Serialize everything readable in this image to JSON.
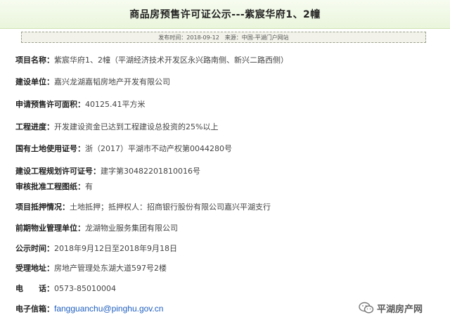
{
  "header": {
    "title": "商品房预售许可证公示---紫宸华府1、2幢"
  },
  "meta": {
    "publish_label": "发布时间：",
    "publish_date": "2018-09-12",
    "source_label": "来源：",
    "source": "中国-平湖门户网站"
  },
  "fields": [
    {
      "label": "项目名称：",
      "value": "紫宸华府1、2幢（平湖经济技术开发区永兴路南侧、新兴二路西侧）"
    },
    {
      "label": "建设单位：",
      "value": "嘉兴龙湖嘉韬房地产开发有限公司"
    },
    {
      "label": "申请预售许可面积：",
      "value": "40125.41平方米"
    },
    {
      "label": "工程进度：",
      "value": "开发建设资金已达到工程建设总投资的25%以上"
    },
    {
      "label": "国有土地使用证号：",
      "value": "浙（2017）平湖市不动产权第0044280号"
    },
    {
      "label": "建设工程规划许可证号：",
      "value": "建字第30482201810016号"
    },
    {
      "label": "审核批准工程图纸：",
      "value": "有"
    },
    {
      "label": "项目抵押情况：",
      "value": "土地抵押；抵押权人：招商银行股份有限公司嘉兴平湖支行"
    },
    {
      "label": "前期物业管理单位：",
      "value": "龙湖物业服务集团有限公司"
    },
    {
      "label": "公示时间：",
      "value": "2018年9月12日至2018年9月18日"
    },
    {
      "label": "受理地址：",
      "value": "房地产管理处东湖大道597号2楼"
    },
    {
      "label": "电　　话：",
      "value": "0573-85010004"
    },
    {
      "label": "电子信箱：",
      "value": "fangguanchu@pinghu.gov.cn"
    }
  ],
  "watermark": {
    "text": "平湖房产网",
    "icon": "wechat-icon"
  }
}
